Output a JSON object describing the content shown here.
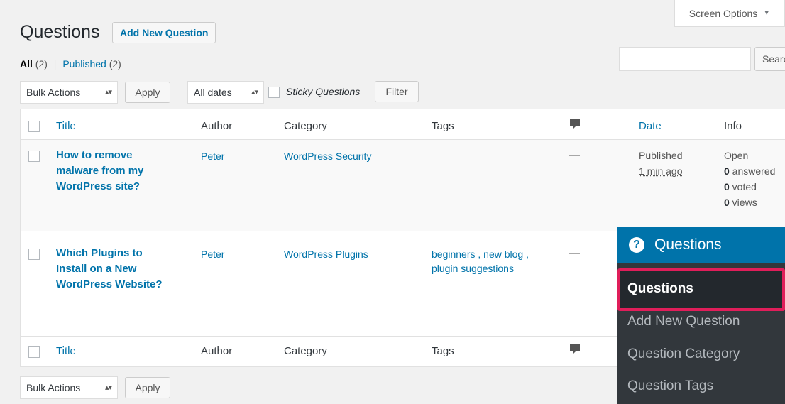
{
  "header": {
    "screen_options": "Screen Options",
    "title": "Questions",
    "add_new": "Add New Question"
  },
  "views": {
    "all_label": "All",
    "all_count": "(2)",
    "separator": "|",
    "published_label": "Published",
    "published_count": "(2)"
  },
  "search": {
    "button": "Search"
  },
  "filters": {
    "bulk_actions": "Bulk Actions",
    "apply": "Apply",
    "dates": "All dates",
    "sticky": "Sticky Questions",
    "filter": "Filter"
  },
  "table": {
    "columns": {
      "title": "Title",
      "author": "Author",
      "category": "Category",
      "tags": "Tags",
      "date": "Date",
      "info": "Info"
    },
    "rows": [
      {
        "title_lines": [
          "How to remove",
          "malware from my",
          "WordPress site?"
        ],
        "author": "Peter",
        "category": "WordPress Security",
        "tags_lines": [],
        "comments": "—",
        "date_status": "Published",
        "date_time": "1 min ago",
        "info": {
          "status": "Open",
          "answered_num": "0",
          "answered_label": " answered",
          "voted_num": "0",
          "voted_label": " voted",
          "views_num": "0",
          "views_label": " views"
        }
      },
      {
        "title_lines": [
          "Which Plugins to",
          "Install on a New",
          "WordPress Website?"
        ],
        "author": "Peter",
        "category": "WordPress Plugins",
        "tags_lines": [
          "beginners , new blog ,",
          "plugin suggestions"
        ],
        "comments": "—"
      }
    ]
  },
  "bottom": {
    "bulk_actions": "Bulk Actions",
    "apply": "Apply"
  },
  "admin_menu": {
    "heading": "Questions",
    "items": [
      "Questions",
      "Add New Question",
      "Question Category",
      "Question Tags"
    ]
  },
  "colors": {
    "link": "#0073aa",
    "menu_bg": "#32373c",
    "menu_active": "#0073aa",
    "highlight_border": "#e01e5a"
  }
}
